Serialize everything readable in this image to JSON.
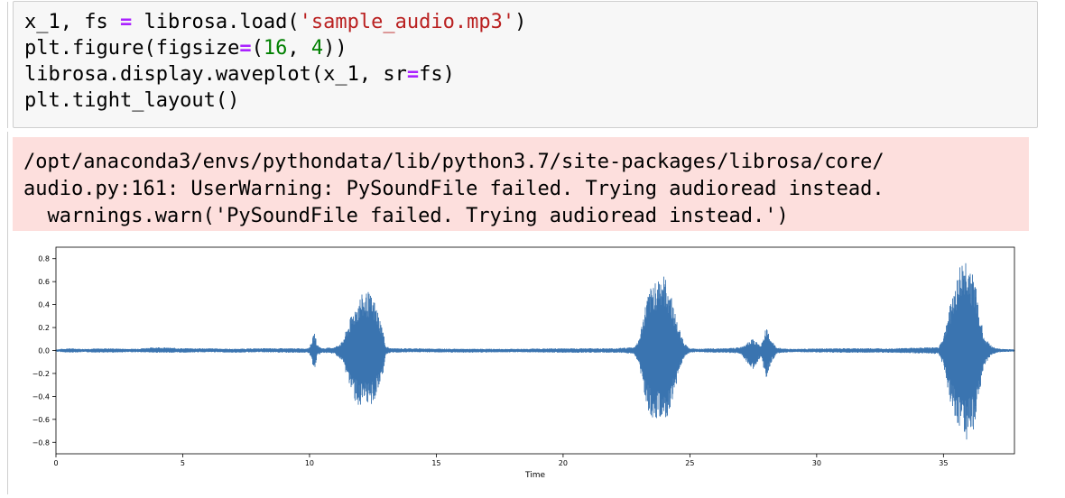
{
  "code_cell": {
    "lines": [
      [
        {
          "t": "x_1, fs ",
          "c": ""
        },
        {
          "t": "=",
          "c": "op"
        },
        {
          "t": " librosa.load(",
          "c": ""
        },
        {
          "t": "'sample_audio.mp3'",
          "c": "str"
        },
        {
          "t": ")",
          "c": ""
        }
      ],
      [
        {
          "t": "plt.figure(figsize",
          "c": ""
        },
        {
          "t": "=",
          "c": "op"
        },
        {
          "t": "(",
          "c": ""
        },
        {
          "t": "16",
          "c": "num"
        },
        {
          "t": ", ",
          "c": ""
        },
        {
          "t": "4",
          "c": "num"
        },
        {
          "t": "))",
          "c": ""
        }
      ],
      [
        {
          "t": "librosa.display.waveplot(x_1, sr",
          "c": ""
        },
        {
          "t": "=",
          "c": "op"
        },
        {
          "t": "fs)",
          "c": ""
        }
      ],
      [
        {
          "t": "plt.tight_layout()",
          "c": ""
        }
      ]
    ]
  },
  "stderr_output": {
    "lines": [
      "/opt/anaconda3/envs/pythondata/lib/python3.7/site-packages/librosa/core/",
      "audio.py:161: UserWarning: PySoundFile failed. Trying audioread instead.",
      "  warnings.warn('PySoundFile failed. Trying audioread instead.')"
    ]
  },
  "chart_data": {
    "type": "area",
    "xlabel": "Time",
    "ylabel": "",
    "xlim": [
      0,
      37.8
    ],
    "ylim": [
      -0.9,
      0.9
    ],
    "xticks": [
      0,
      5,
      10,
      15,
      20,
      25,
      30,
      35
    ],
    "yticks": [
      0.8,
      0.6,
      0.4,
      0.2,
      0.0,
      -0.2,
      -0.4,
      -0.6,
      -0.8
    ],
    "ytick_labels": [
      "0.8",
      "0.6",
      "0.4",
      "0.2",
      "0.0",
      "−0.2",
      "−0.4",
      "−0.6",
      "−0.8"
    ],
    "grid": false,
    "color": "#3a74b0",
    "series": [
      {
        "x": [
          0,
          0.5,
          1,
          2,
          3,
          4,
          5,
          6,
          7,
          8,
          9,
          9.9,
          10.0,
          10.2,
          10.3,
          10.5,
          11.0,
          11.3,
          11.7,
          12.0,
          12.3,
          12.6,
          12.9,
          13.0,
          13.2,
          14,
          16,
          18,
          20,
          22,
          22.8,
          23.0,
          23.3,
          23.6,
          23.9,
          24.2,
          24.5,
          24.8,
          25.0,
          25.3,
          26,
          26.5,
          27.0,
          27.3,
          27.5,
          27.8,
          28.0,
          28.2,
          28.4,
          28.6,
          29,
          31,
          33,
          34.8,
          35.0,
          35.3,
          35.6,
          35.9,
          36.2,
          36.4,
          36.6,
          36.9,
          37.1,
          37.3,
          37.8
        ],
        "upper": [
          0.01,
          0.02,
          0.015,
          0.02,
          0.015,
          0.03,
          0.02,
          0.02,
          0.015,
          0.02,
          0.02,
          0.02,
          0.03,
          0.16,
          0.05,
          0.02,
          0.03,
          0.08,
          0.34,
          0.48,
          0.52,
          0.42,
          0.18,
          0.04,
          0.02,
          0.02,
          0.015,
          0.015,
          0.02,
          0.02,
          0.03,
          0.1,
          0.46,
          0.62,
          0.68,
          0.56,
          0.24,
          0.06,
          0.02,
          0.015,
          0.02,
          0.02,
          0.03,
          0.08,
          0.1,
          0.04,
          0.2,
          0.1,
          0.03,
          0.02,
          0.015,
          0.02,
          0.02,
          0.03,
          0.12,
          0.44,
          0.72,
          0.83,
          0.66,
          0.38,
          0.12,
          0.04,
          0.02,
          0.015,
          0.01
        ],
        "lower": [
          -0.01,
          -0.02,
          -0.015,
          -0.02,
          -0.015,
          -0.02,
          -0.02,
          -0.015,
          -0.02,
          -0.015,
          -0.02,
          -0.02,
          -0.03,
          -0.18,
          -0.05,
          -0.02,
          -0.03,
          -0.1,
          -0.4,
          -0.52,
          -0.5,
          -0.44,
          -0.2,
          -0.04,
          -0.02,
          -0.015,
          -0.02,
          -0.015,
          -0.02,
          -0.02,
          -0.03,
          -0.12,
          -0.5,
          -0.62,
          -0.63,
          -0.58,
          -0.26,
          -0.05,
          -0.02,
          -0.015,
          -0.02,
          -0.02,
          -0.03,
          -0.12,
          -0.18,
          -0.05,
          -0.25,
          -0.12,
          -0.03,
          -0.02,
          -0.015,
          -0.02,
          -0.02,
          -0.03,
          -0.14,
          -0.48,
          -0.66,
          -0.78,
          -0.7,
          -0.42,
          -0.14,
          -0.04,
          -0.02,
          -0.015,
          -0.01
        ]
      }
    ]
  }
}
